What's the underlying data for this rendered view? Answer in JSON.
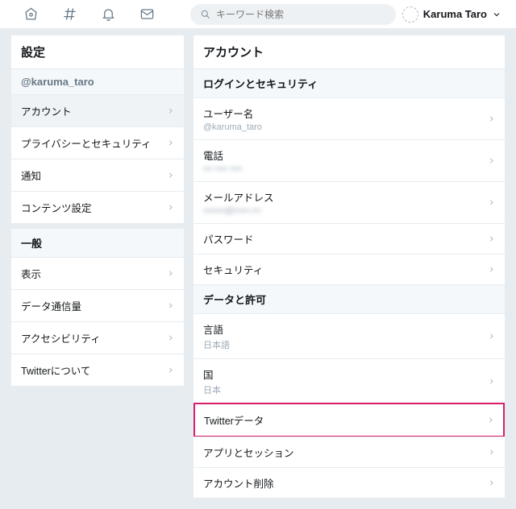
{
  "topbar": {
    "search_placeholder": "キーワード検索",
    "user_name": "Karuma Taro"
  },
  "sidebar": {
    "title": "設定",
    "username": "@karuma_taro",
    "group1": [
      {
        "label": "アカウント",
        "active": true
      },
      {
        "label": "プライバシーとセキュリティ"
      },
      {
        "label": "通知"
      },
      {
        "label": "コンテンツ設定"
      }
    ],
    "group2_title": "一般",
    "group2": [
      {
        "label": "表示"
      },
      {
        "label": "データ通信量"
      },
      {
        "label": "アクセシビリティ"
      },
      {
        "label": "Twitterについて"
      }
    ]
  },
  "main": {
    "title": "アカウント",
    "section1_title": "ログインとセキュリティ",
    "section1": [
      {
        "label": "ユーザー名",
        "sub": "@karuma_taro"
      },
      {
        "label": "電話",
        "sub": "••• •••• ••••",
        "blur": true
      },
      {
        "label": "メールアドレス",
        "sub": "•••••••@•••••.•••",
        "blur": true
      },
      {
        "label": "パスワード"
      },
      {
        "label": "セキュリティ"
      }
    ],
    "section2_title": "データと許可",
    "section2": [
      {
        "label": "言語",
        "sub": "日本語"
      },
      {
        "label": "国",
        "sub": "日本"
      },
      {
        "label": "Twitterデータ",
        "highlight": true
      },
      {
        "label": "アプリとセッション"
      },
      {
        "label": "アカウント削除"
      }
    ]
  }
}
